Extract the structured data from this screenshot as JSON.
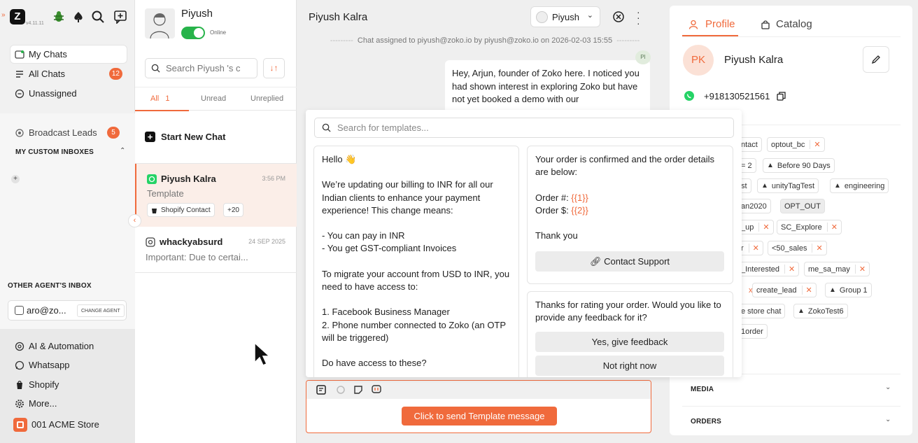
{
  "app": {
    "version": "v4.11.11"
  },
  "nav": {
    "my_chats": "My Chats",
    "all_chats": "All Chats",
    "all_chats_count": "12",
    "unassigned": "Unassigned",
    "broadcast_leads": "Broadcast Leads",
    "broadcast_count": "5",
    "custom_inboxes": "MY CUSTOM INBOXES",
    "other_agents": "OTHER AGENT'S INBOX",
    "other_agent_email": "aro@zo...",
    "change_agent": "CHANGE AGENT",
    "ai_automation": "AI & Automation",
    "whatsapp": "Whatsapp",
    "shopify": "Shopify",
    "more": "More...",
    "store": "001 ACME Store"
  },
  "list": {
    "agent_name": "Piyush",
    "online": "Online",
    "search_placeholder": "Search Piyush 's c",
    "tabs": [
      {
        "label": "All",
        "count": "1"
      },
      {
        "label": "Unread"
      },
      {
        "label": "Unreplied"
      }
    ],
    "start_new_chat": "Start New Chat",
    "chats": [
      {
        "name": "Piyush Kalra",
        "time": "3:56 PM",
        "preview": "Template",
        "tag": "Shopify Contact",
        "more": "+20"
      },
      {
        "name": "whackyabsurd",
        "time": "24 SEP 2025",
        "preview": "Important: Due to certai..."
      }
    ]
  },
  "conv": {
    "title": "Piyush Kalra",
    "agent": "Piyush",
    "assign_line": "Chat assigned to piyush@zoko.io by piyush@zoko.io on 2026-02-03 15:55",
    "pi_initials": "PI",
    "message": "Hey, Arjun, founder of Zoko here. I noticed you had shown interest in exploring Zoko but have not yet booked a demo with our",
    "template_search_placeholder": "Search for templates...",
    "templates": {
      "billing": {
        "l1": "Hello 👋",
        "l2": "We’re updating our billing to INR for all our Indian clients to enhance your payment experience! This change means:",
        "l3": "- You can pay in INR",
        "l4": "- You get GST-compliant Invoices",
        "l5": "To migrate your account from USD to INR, you need to have access to:",
        "l6": "1. Facebook Business Manager",
        "l7": "2. Phone number connected to Zoko (an OTP will be triggered)",
        "l8": "Do have access to these?"
      },
      "order": {
        "l1": "Your order is confirmed and the order details are below:",
        "order_no_label": "Order #: ",
        "order_no_var": "{{1}}",
        "order_amt_label": "Order $: ",
        "order_amt_var": "{{2}}",
        "thanks": "Thank you",
        "button": "Contact Support"
      },
      "feedback": {
        "text": "Thanks for rating your order. Would you like to provide any feedback for it?",
        "yes": "Yes, give feedback",
        "no": "Not right now"
      }
    },
    "send_button": "Click to send Template message"
  },
  "profile": {
    "tabs": {
      "profile": "Profile",
      "catalog": "Catalog"
    },
    "initials": "PK",
    "name": "Piyush Kalra",
    "phone": "+918130521561",
    "tags": {
      "t1": "ntact",
      "t2": "optout_bc",
      "t3": "= 2",
      "t4": "Before 90 Days",
      "t5": "st",
      "t6": "unityTagTest",
      "t7": "engineering",
      "t8": "an2020",
      "t9": "OPT_OUT",
      "t10": "_up",
      "t11": "SC_Explore",
      "t12": "r",
      "t13": "<50_sales",
      "t14": "_Interested",
      "t15": "me_sa_may",
      "t16": "x",
      "t17": "create_lead",
      "t18": "Group 1",
      "t19": "e store chat",
      "t20": "ZokoTest6",
      "t21": "1order"
    },
    "media": "MEDIA",
    "orders": "ORDERS"
  },
  "colors": {
    "accent": "#f06a3c",
    "online": "#27b34a",
    "whatsapp": "#25d366"
  }
}
